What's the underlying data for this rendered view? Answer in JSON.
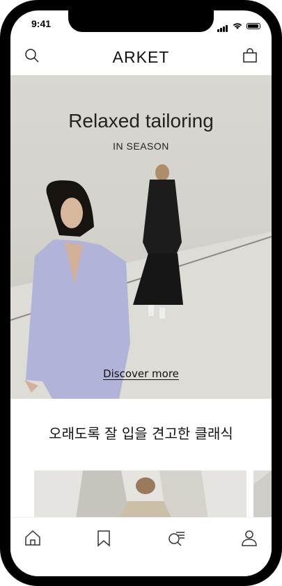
{
  "status_bar": {
    "time": "9:41"
  },
  "header": {
    "brand": "ARKET"
  },
  "hero": {
    "title": "Relaxed tailoring",
    "subtitle": "IN SEASON",
    "cta": "Discover more"
  },
  "section": {
    "title": "오래도록 잘 입을 견고한 클래식"
  },
  "icons": {
    "search": "search-icon",
    "bag": "shopping-bag-icon",
    "home": "home-icon",
    "saved": "bookmark-icon",
    "explore": "explore-icon",
    "account": "user-icon"
  },
  "colors": {
    "frame": "#000000",
    "background": "#ffffff",
    "text": "#111111"
  }
}
